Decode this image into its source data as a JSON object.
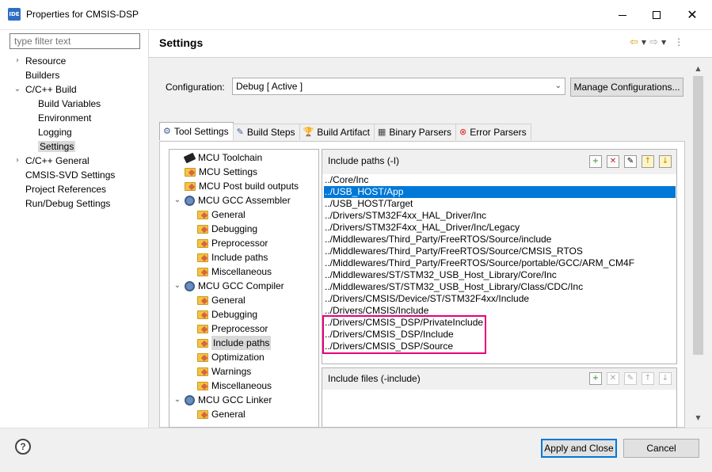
{
  "window": {
    "app_icon": "IDE",
    "title": "Properties for CMSIS-DSP"
  },
  "left_nav": {
    "filter_placeholder": "type filter text",
    "items": [
      {
        "label": "Resource",
        "caret": "›"
      },
      {
        "label": "Builders"
      },
      {
        "label": "C/C++ Build",
        "caret": "⌄"
      },
      {
        "label": "Build Variables"
      },
      {
        "label": "Environment"
      },
      {
        "label": "Logging"
      },
      {
        "label": "Settings",
        "selected": true
      },
      {
        "label": "C/C++ General",
        "caret": "›"
      },
      {
        "label": "CMSIS-SVD Settings"
      },
      {
        "label": "Project References"
      },
      {
        "label": "Run/Debug Settings"
      }
    ]
  },
  "settings": {
    "title": "Settings",
    "configuration_label": "Configuration:",
    "configuration_value": "Debug  [ Active ]",
    "manage_button": "Manage Configurations..."
  },
  "tabs": [
    {
      "label": "Tool Settings",
      "icon": "tool-settings-icon",
      "active": true
    },
    {
      "label": "Build Steps",
      "icon": "build-steps-icon"
    },
    {
      "label": "Build Artifact",
      "icon": "build-artifact-icon"
    },
    {
      "label": "Binary Parsers",
      "icon": "binary-parsers-icon"
    },
    {
      "label": "Error Parsers",
      "icon": "error-parsers-icon"
    }
  ],
  "tool_tree": [
    {
      "label": "MCU Toolchain",
      "icon": "chip-icon"
    },
    {
      "label": "MCU Settings",
      "icon": "folder-icon"
    },
    {
      "label": "MCU Post build outputs",
      "icon": "folder-icon"
    },
    {
      "label": "MCU GCC Assembler",
      "icon": "gear-icon",
      "caret": "⌄"
    },
    {
      "label": "General",
      "icon": "folder-icon"
    },
    {
      "label": "Debugging",
      "icon": "folder-icon"
    },
    {
      "label": "Preprocessor",
      "icon": "folder-icon"
    },
    {
      "label": "Include paths",
      "icon": "folder-icon"
    },
    {
      "label": "Miscellaneous",
      "icon": "folder-icon"
    },
    {
      "label": "MCU GCC Compiler",
      "icon": "gear-icon",
      "caret": "⌄"
    },
    {
      "label": "General",
      "icon": "folder-icon"
    },
    {
      "label": "Debugging",
      "icon": "folder-icon"
    },
    {
      "label": "Preprocessor",
      "icon": "folder-icon"
    },
    {
      "label": "Include paths",
      "icon": "folder-icon",
      "selected": true
    },
    {
      "label": "Optimization",
      "icon": "folder-icon"
    },
    {
      "label": "Warnings",
      "icon": "folder-icon"
    },
    {
      "label": "Miscellaneous",
      "icon": "folder-icon"
    },
    {
      "label": "MCU GCC Linker",
      "icon": "gear-icon",
      "caret": "⌄"
    },
    {
      "label": "General",
      "icon": "folder-icon"
    }
  ],
  "include_paths": {
    "title": "Include paths (-I)",
    "items": [
      "../Core/Inc",
      "../USB_HOST/App",
      "../USB_HOST/Target",
      "../Drivers/STM32F4xx_HAL_Driver/Inc",
      "../Drivers/STM32F4xx_HAL_Driver/Inc/Legacy",
      "../Middlewares/Third_Party/FreeRTOS/Source/include",
      "../Middlewares/Third_Party/FreeRTOS/Source/CMSIS_RTOS",
      "../Middlewares/Third_Party/FreeRTOS/Source/portable/GCC/ARM_CM4F",
      "../Middlewares/ST/STM32_USB_Host_Library/Core/Inc",
      "../Middlewares/ST/STM32_USB_Host_Library/Class/CDC/Inc",
      "../Drivers/CMSIS/Device/ST/STM32F4xx/Include",
      "../Drivers/CMSIS/Include",
      "../Drivers/CMSIS_DSP/PrivateInclude",
      "../Drivers/CMSIS_DSP/Include",
      "../Drivers/CMSIS_DSP/Source"
    ],
    "selected_index": 1,
    "highlight_color": "#e6007e"
  },
  "include_files": {
    "title": "Include files (-include)"
  },
  "footer": {
    "help": "?",
    "apply_button": "Apply and Close",
    "cancel_button": "Cancel"
  }
}
